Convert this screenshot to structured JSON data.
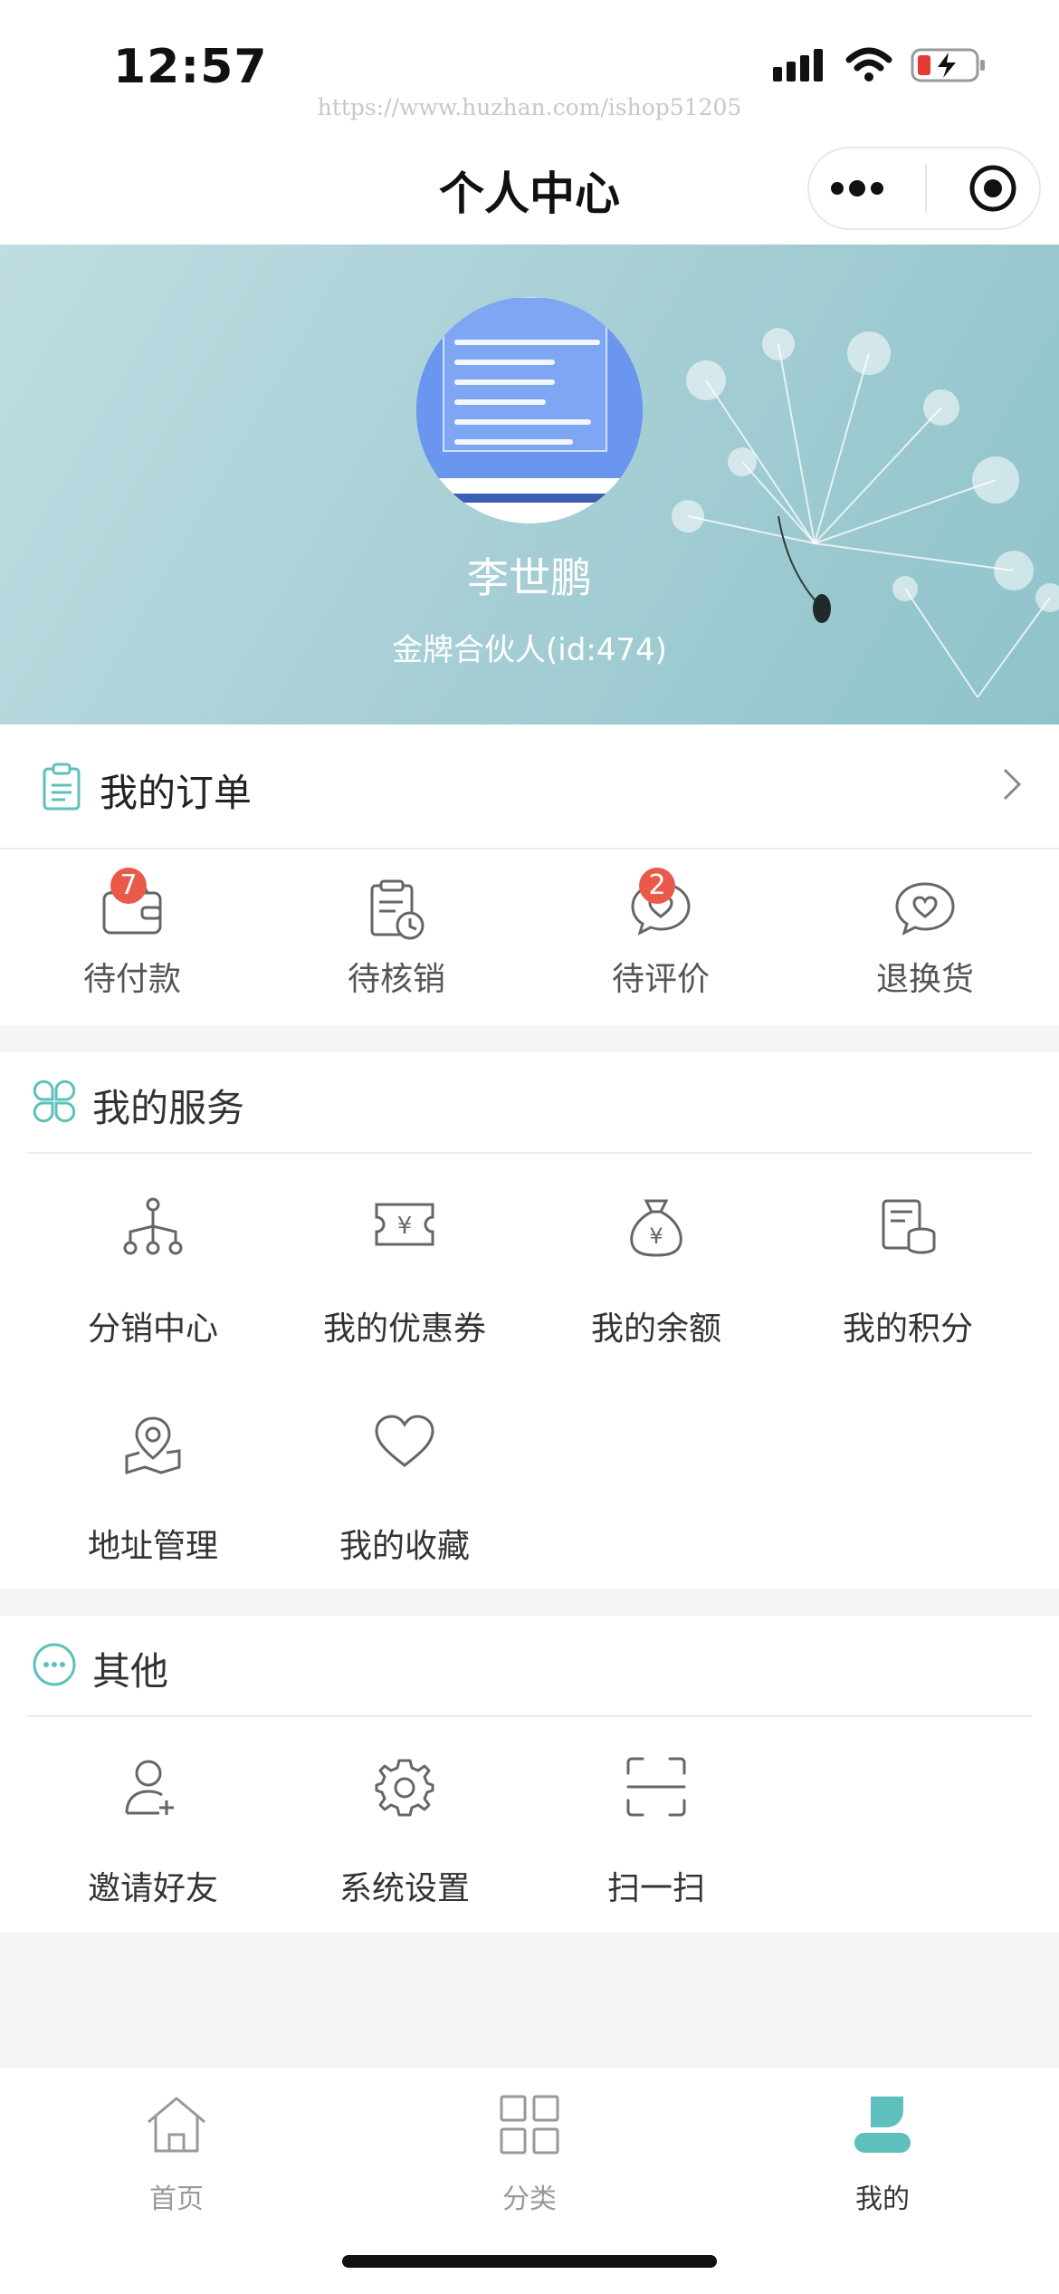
{
  "status_bar": {
    "time": "12:57",
    "watermark": "https://www.huzhan.com/ishop51205"
  },
  "navbar": {
    "title": "个人中心"
  },
  "profile": {
    "name": "李世鹏",
    "level": "金牌合伙人(id:474)"
  },
  "orders": {
    "title": "我的订单",
    "items": [
      {
        "label": "待付款",
        "badge": "7",
        "icon": "wallet-icon"
      },
      {
        "label": "待核销",
        "badge": "",
        "icon": "clipboard-clock-icon"
      },
      {
        "label": "待评价",
        "badge": "2",
        "icon": "chat-heart-icon"
      },
      {
        "label": "退换货",
        "badge": "",
        "icon": "chat-heart-icon"
      }
    ]
  },
  "services": {
    "title": "我的服务",
    "items": [
      {
        "label": "分销中心",
        "icon": "network-icon"
      },
      {
        "label": "我的优惠券",
        "icon": "ticket-icon"
      },
      {
        "label": "我的余额",
        "icon": "money-bag-icon"
      },
      {
        "label": "我的积分",
        "icon": "coins-icon"
      },
      {
        "label": "地址管理",
        "icon": "map-pin-icon"
      },
      {
        "label": "我的收藏",
        "icon": "heart-icon"
      }
    ]
  },
  "other": {
    "title": "其他",
    "items": [
      {
        "label": "邀请好友",
        "icon": "add-user-icon"
      },
      {
        "label": "系统设置",
        "icon": "gear-icon"
      },
      {
        "label": "扫一扫",
        "icon": "scan-icon"
      }
    ]
  },
  "tabbar": {
    "items": [
      {
        "label": "首页",
        "icon": "home-icon"
      },
      {
        "label": "分类",
        "icon": "grid-icon"
      },
      {
        "label": "我的",
        "icon": "user-icon"
      }
    ],
    "active_index": 2
  },
  "colors": {
    "accent": "#5dc0bd",
    "badge": "#ea5a4a",
    "icon_gray": "#666666"
  }
}
